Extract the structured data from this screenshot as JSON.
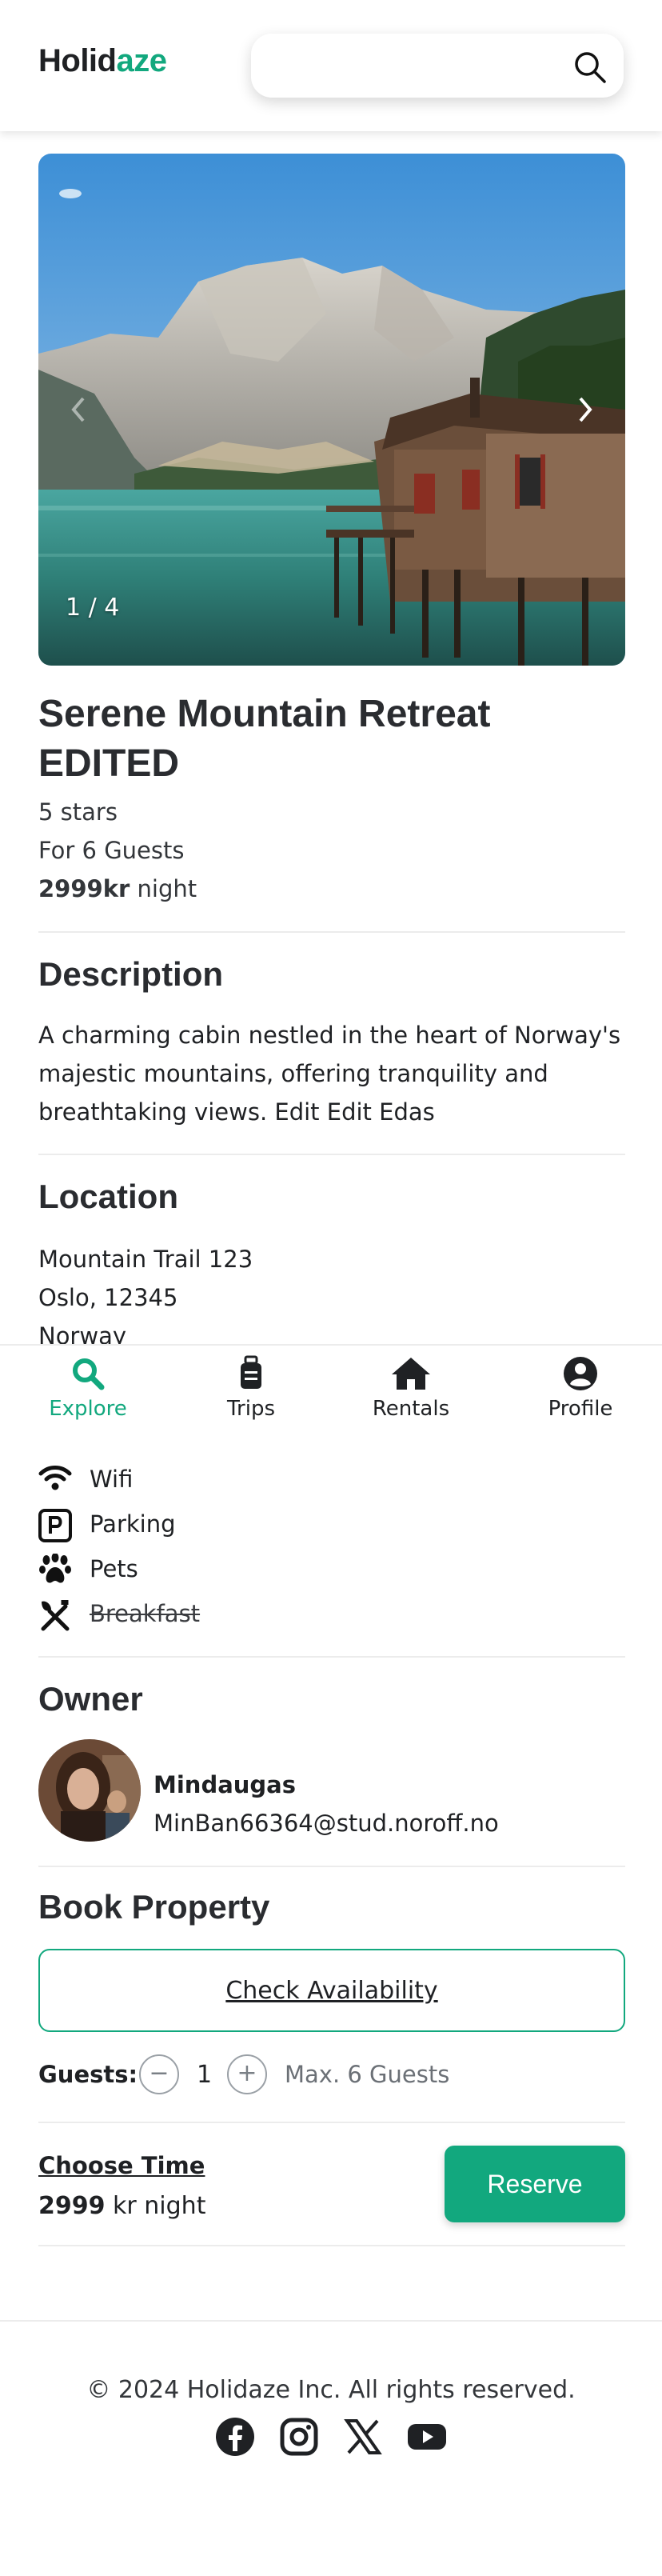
{
  "header": {
    "logo_part1": "Holid",
    "logo_part2": "aze",
    "search_placeholder": "",
    "search_icon": "search-icon"
  },
  "gallery": {
    "counter": "1 / 4",
    "prev_icon": "chevron-left-icon",
    "next_icon": "chevron-right-icon"
  },
  "venue": {
    "title_line1": "Serene Mountain Retreat",
    "title_line2": "EDITED",
    "rating": "5 stars",
    "guests": "For 6 Guests",
    "price": "2999kr",
    "price_unit": "night"
  },
  "description": {
    "heading": "Description",
    "line1": "A charming cabin nestled in the heart of Norway's",
    "line2": "majestic mountains, offering tranquility and",
    "line3": "breathtaking views. Edit Edit Edas"
  },
  "location": {
    "heading": "Location",
    "address": "Mountain Trail 123",
    "city": "Oslo, 12345",
    "country": "Norway"
  },
  "bottom_nav": {
    "items": [
      {
        "label": "Explore",
        "icon": "search-icon",
        "active": true
      },
      {
        "label": "Trips",
        "icon": "suitcase-icon",
        "active": false
      },
      {
        "label": "Rentals",
        "icon": "home-icon",
        "active": false
      },
      {
        "label": "Profile",
        "icon": "user-icon",
        "active": false
      }
    ],
    "active_color": "#12a87e"
  },
  "amenities": [
    {
      "label": "Wifi",
      "icon": "wifi-icon",
      "available": true
    },
    {
      "label": "Parking",
      "icon": "parking-icon",
      "available": true
    },
    {
      "label": "Pets",
      "icon": "paw-icon",
      "available": true
    },
    {
      "label": "Breakfast",
      "icon": "utensils-icon",
      "available": false
    }
  ],
  "owner": {
    "heading": "Owner",
    "name": "Mindaugas",
    "email": "MinBan66364@stud.noroff.no"
  },
  "booking": {
    "heading": "Book Property",
    "check_availability": "Check Availability",
    "guests_label": "Guests:",
    "guests_count": "1",
    "decrement": "−",
    "increment": "+",
    "max_guests": "Max. 6 Guests",
    "choose_time": "Choose Time",
    "price_value": "2999",
    "price_suffix": "kr night",
    "reserve_label": "Reserve"
  },
  "footer": {
    "copyright": "© 2024 Holidaze Inc. All rights reserved.",
    "social_icons": [
      "facebook-icon",
      "instagram-icon",
      "x-icon",
      "youtube-icon"
    ]
  },
  "colors": {
    "accent": "#12a87e",
    "text": "#1f2124"
  }
}
